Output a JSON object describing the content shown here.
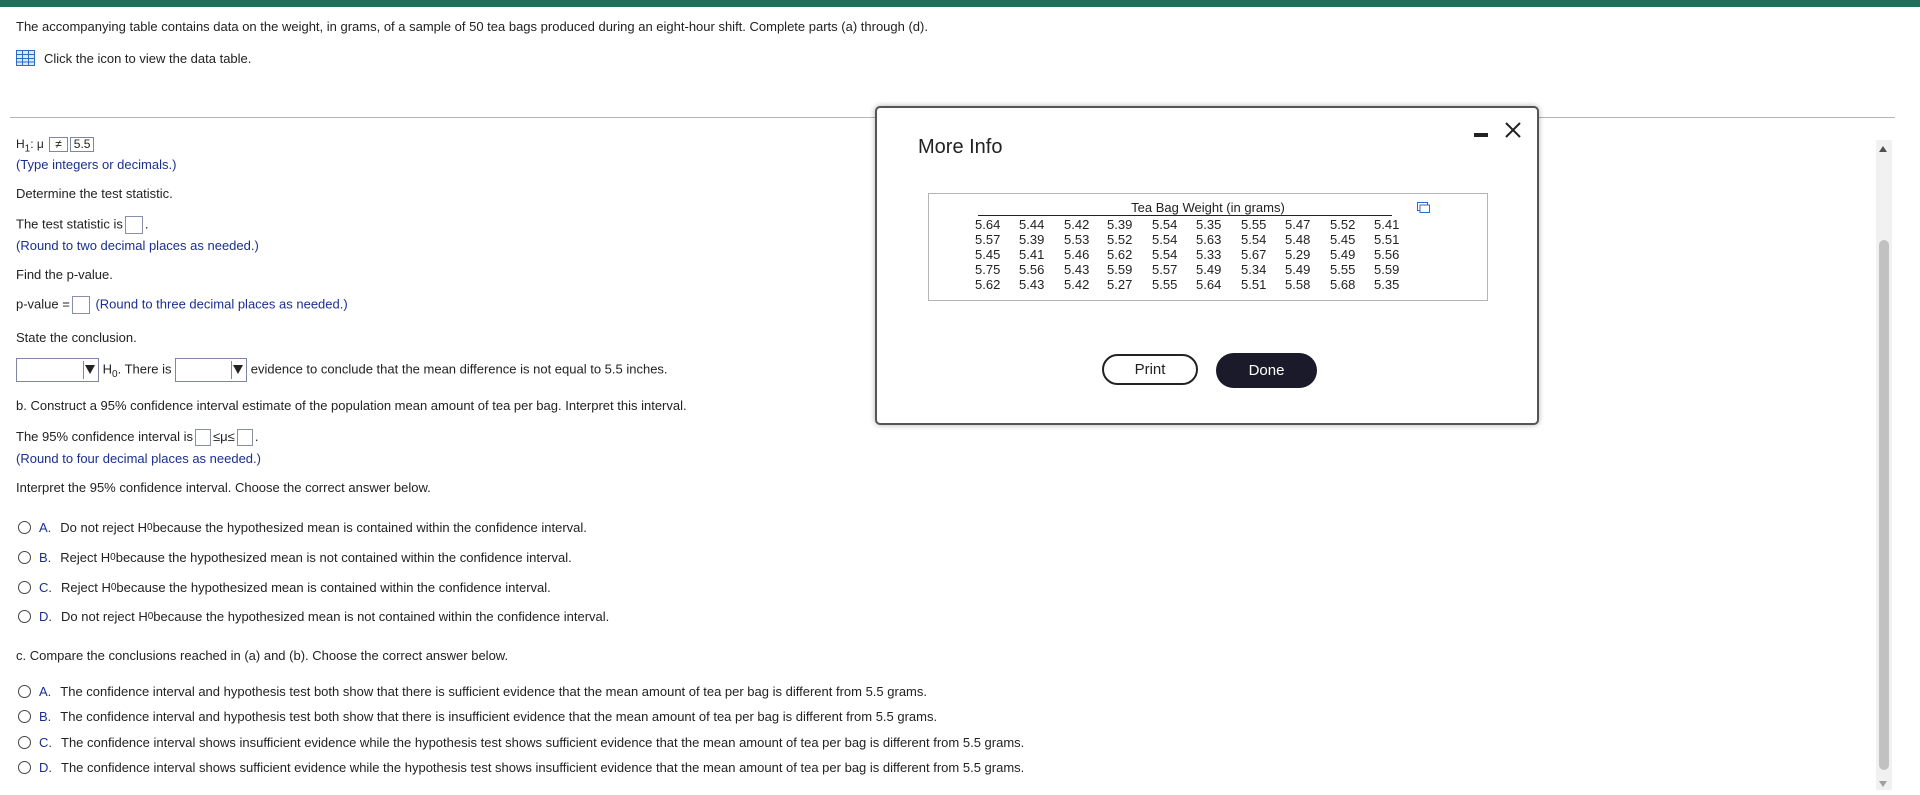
{
  "intro": "The accompanying table contains data on the weight, in grams, of a sample of 50 tea bags produced during an eight-hour shift. Complete parts (a) through (d).",
  "view_link": "Click the icon to view the data table.",
  "h1": {
    "label": "H",
    "sub": "1",
    "mu": ": μ",
    "op": "≠",
    "value": "5.5"
  },
  "h1_hint": "(Type integers or decimals.)",
  "test_stat_prompt": "Determine the test statistic.",
  "test_stat_label": "The test statistic is",
  "test_stat_hint": "(Round to two decimal places as needed.)",
  "pvalue_prompt": "Find the p-value.",
  "pvalue_label": "p-value =",
  "pvalue_hint": "(Round to three decimal places as needed.)",
  "conclusion_prompt": "State the conclusion.",
  "conclusion": {
    "h0": "H",
    "h0_sub": "0",
    "text1": ". There is",
    "text2": "evidence to conclude that the mean difference is not equal to 5.5 inches."
  },
  "part_b": "b. Construct a 95% confidence interval estimate of the population mean amount of tea per bag. Interpret this interval.",
  "ci_label": "The 95% confidence interval is",
  "ci_mid": "≤μ≤",
  "ci_hint": "(Round to four decimal places as needed.)",
  "ci_interpret": "Interpret the 95% confidence interval. Choose the correct answer below.",
  "options_b": [
    {
      "letter": "A.",
      "pre": "Do not reject H",
      "sub": "0",
      "post": " because the hypothesized mean is contained within the confidence interval."
    },
    {
      "letter": "B.",
      "pre": "Reject H",
      "sub": "0",
      "post": " because the hypothesized mean is not contained within the confidence interval."
    },
    {
      "letter": "C.",
      "pre": "Reject H",
      "sub": "0",
      "post": " because the hypothesized mean is contained within the confidence interval."
    },
    {
      "letter": "D.",
      "pre": "Do not reject H",
      "sub": "0",
      "post": " because the hypothesized mean is not contained within the confidence interval."
    }
  ],
  "part_c": "c. Compare the conclusions reached in (a) and (b). Choose the correct answer below.",
  "options_c": [
    {
      "letter": "A.",
      "text": "The confidence interval and hypothesis test both show that there is sufficient evidence that the mean amount of tea per bag is different from 5.5 grams."
    },
    {
      "letter": "B.",
      "text": "The confidence interval and hypothesis test both show that there is insufficient evidence that the mean amount of tea per bag is different from 5.5 grams."
    },
    {
      "letter": "C.",
      "text": "The confidence interval shows insufficient evidence while the hypothesis test shows sufficient evidence that the mean amount of tea per bag is different from 5.5 grams."
    },
    {
      "letter": "D.",
      "text": "The confidence interval shows sufficient evidence while the hypothesis test shows insufficient evidence that the mean amount of tea per bag is different from 5.5 grams."
    }
  ],
  "modal": {
    "title": "More Info",
    "table_title": "Tea Bag Weight (in grams)",
    "rows": [
      [
        "5.64",
        "5.44",
        "5.42",
        "5.39",
        "5.54",
        "5.35",
        "5.55",
        "5.47",
        "5.52",
        "5.41"
      ],
      [
        "5.57",
        "5.39",
        "5.53",
        "5.52",
        "5.54",
        "5.63",
        "5.54",
        "5.48",
        "5.45",
        "5.51"
      ],
      [
        "5.45",
        "5.41",
        "5.46",
        "5.62",
        "5.54",
        "5.33",
        "5.67",
        "5.29",
        "5.49",
        "5.56"
      ],
      [
        "5.75",
        "5.56",
        "5.43",
        "5.59",
        "5.57",
        "5.49",
        "5.34",
        "5.49",
        "5.55",
        "5.59"
      ],
      [
        "5.62",
        "5.43",
        "5.42",
        "5.27",
        "5.55",
        "5.64",
        "5.51",
        "5.58",
        "5.68",
        "5.35"
      ]
    ],
    "print_label": "Print",
    "done_label": "Done"
  },
  "colors": {
    "accent_bar": "#1f6f5c",
    "hint_blue": "#1a2f8f",
    "done_bg": "#1a1a2a"
  },
  "icons": {
    "view": "table-grid-icon",
    "copy": "copy-icon",
    "close": "close-icon",
    "minimize": "minimize-icon"
  }
}
